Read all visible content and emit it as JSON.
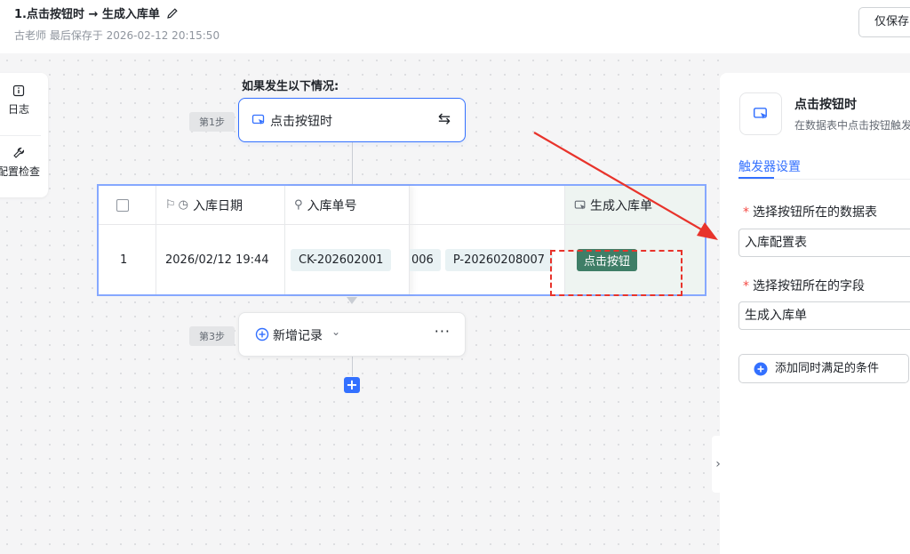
{
  "header": {
    "title": "1.点击按钮时 → 生成入库单",
    "subtitle": "古老师 最后保存于 2026-02-12 20:15:50",
    "save_label": "仅保存"
  },
  "tools": {
    "log_label": "日志",
    "check_label": "配置检查"
  },
  "flow": {
    "condition_label": "如果发生以下情况:",
    "step1_tag": "第1步",
    "step1_label": "点击按钮时",
    "step3_tag": "第3步",
    "step3_label": "新增记录"
  },
  "table": {
    "headers": {
      "date": "入库日期",
      "no": "入库单号",
      "button": "生成入库单"
    },
    "row": {
      "index": "1",
      "date": "2026/02/12 19:44",
      "no": "CK-202602001",
      "cut_value": "006",
      "p_value": "P-20260208007",
      "button_label": "点击按钮"
    }
  },
  "panel": {
    "title": "点击按钮时",
    "desc": "在数据表中点击按钮触发",
    "tab": "触发器设置",
    "label_table": "选择按钮所在的数据表",
    "value_table": "入库配置表",
    "label_field": "选择按钮所在的字段",
    "value_field": "生成入库单",
    "add_condition": "添加同时满足的条件"
  },
  "colors": {
    "accent": "#3370ff",
    "button_green": "#3f7e67",
    "highlight_red": "#e8332b"
  }
}
